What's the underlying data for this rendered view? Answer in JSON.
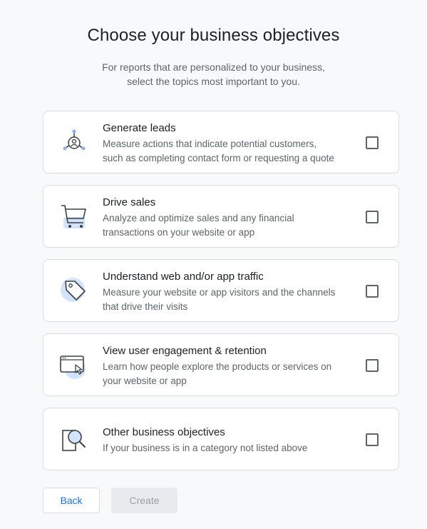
{
  "header": {
    "title": "Choose your business objectives",
    "subtitle_line1": "For reports that are personalized to your business,",
    "subtitle_line2": "select the topics most important to you."
  },
  "objectives": [
    {
      "title": "Generate leads",
      "desc_line1": "Measure actions that indicate potential customers,",
      "desc_line2": "such as completing contact form or requesting a quote",
      "icon": "leads-icon",
      "checked": false
    },
    {
      "title": "Drive sales",
      "desc_line1": "Analyze and optimize sales and any financial",
      "desc_line2": "transactions on your website or app",
      "icon": "shopping-cart-icon",
      "checked": false
    },
    {
      "title": "Understand web and/or app traffic",
      "desc_line1": "Measure your website or app visitors and the channels",
      "desc_line2": "that drive their visits",
      "icon": "tag-icon",
      "checked": false
    },
    {
      "title": "View user engagement & retention",
      "desc_line1": "Learn how people explore the products or services on",
      "desc_line2": "your website or app",
      "icon": "browser-cursor-icon",
      "checked": false
    },
    {
      "title": "Other business objectives",
      "desc_line1": "If your business is in a category not listed above",
      "icon": "magnifier-icon",
      "checked": false
    }
  ],
  "actions": {
    "back_label": "Back",
    "create_label": "Create"
  },
  "colors": {
    "accent": "#1a73e8",
    "icon_highlight": "#d2e3fc",
    "background": "#f8f9fa"
  }
}
